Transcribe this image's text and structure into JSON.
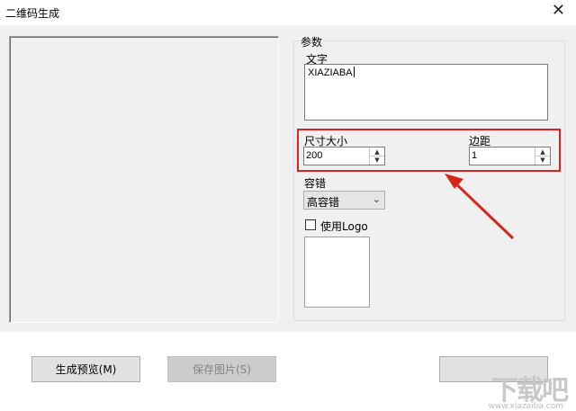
{
  "window": {
    "title": "二维码生成",
    "close_glyph": "✕"
  },
  "params": {
    "group_label": "参数",
    "text_label": "文字",
    "text_value": "XIAZIABA",
    "size_label": "尺寸大小",
    "size_value": "200",
    "margin_label": "边距",
    "margin_value": "1",
    "ecc_label": "容错",
    "ecc_value": "高容错",
    "use_logo_label": "使用Logo",
    "use_logo_checked": false
  },
  "buttons": {
    "preview": "生成预览(M)",
    "save": "保存图片(S)"
  },
  "watermark": {
    "brand": "下载吧",
    "url": "www.xiazaiba.com"
  },
  "colors": {
    "highlight": "#e02020",
    "window_bg": "#f0f0f0"
  }
}
